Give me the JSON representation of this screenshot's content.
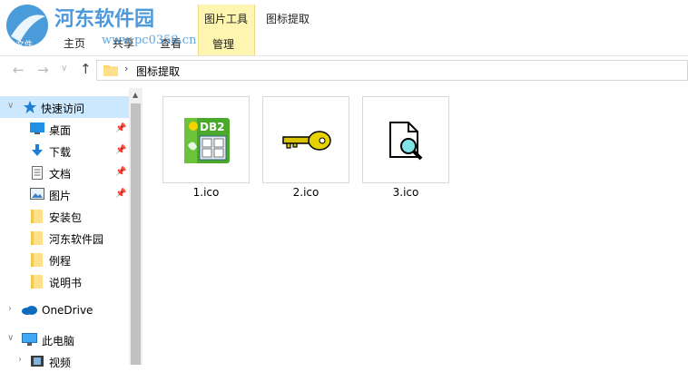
{
  "watermark": {
    "site_name": "河东软件园",
    "site_url": "www.pc0359.cn",
    "logo_text": "文件"
  },
  "ribbon": {
    "tabs": [
      {
        "label": "主页"
      },
      {
        "label": "共享"
      },
      {
        "label": "查看"
      }
    ],
    "context_group_title": "图片工具",
    "context_tab": "管理",
    "window_title": "图标提取"
  },
  "address": {
    "path": "图标提取"
  },
  "nav_icons": {
    "back": "←",
    "forward": "→",
    "recent": "∨",
    "up": "↑",
    "separator": "›"
  },
  "sidebar": {
    "quick_access": "快速访问",
    "items": [
      {
        "label": "桌面",
        "icon": "desktop-icon",
        "pinned": true
      },
      {
        "label": "下载",
        "icon": "download-icon",
        "pinned": true
      },
      {
        "label": "文档",
        "icon": "document-icon",
        "pinned": true
      },
      {
        "label": "图片",
        "icon": "pictures-icon",
        "pinned": true
      },
      {
        "label": "安装包",
        "icon": "folder-icon",
        "pinned": false
      },
      {
        "label": "河东软件园",
        "icon": "folder-icon",
        "pinned": false
      },
      {
        "label": "例程",
        "icon": "folder-icon",
        "pinned": false
      },
      {
        "label": "说明书",
        "icon": "folder-icon",
        "pinned": false
      }
    ],
    "onedrive": "OneDrive",
    "this_pc": "此电脑",
    "videos": "视频"
  },
  "files": [
    {
      "name": "1.ico",
      "icon": "db2-app-icon",
      "icon_text": "DB2"
    },
    {
      "name": "2.ico",
      "icon": "key-icon"
    },
    {
      "name": "3.ico",
      "icon": "file-search-icon"
    }
  ],
  "colors": {
    "selection": "#cce8ff",
    "context_tab": "#fdf5b0",
    "folder": "#ffd564",
    "accent_blue": "#0078d7"
  }
}
